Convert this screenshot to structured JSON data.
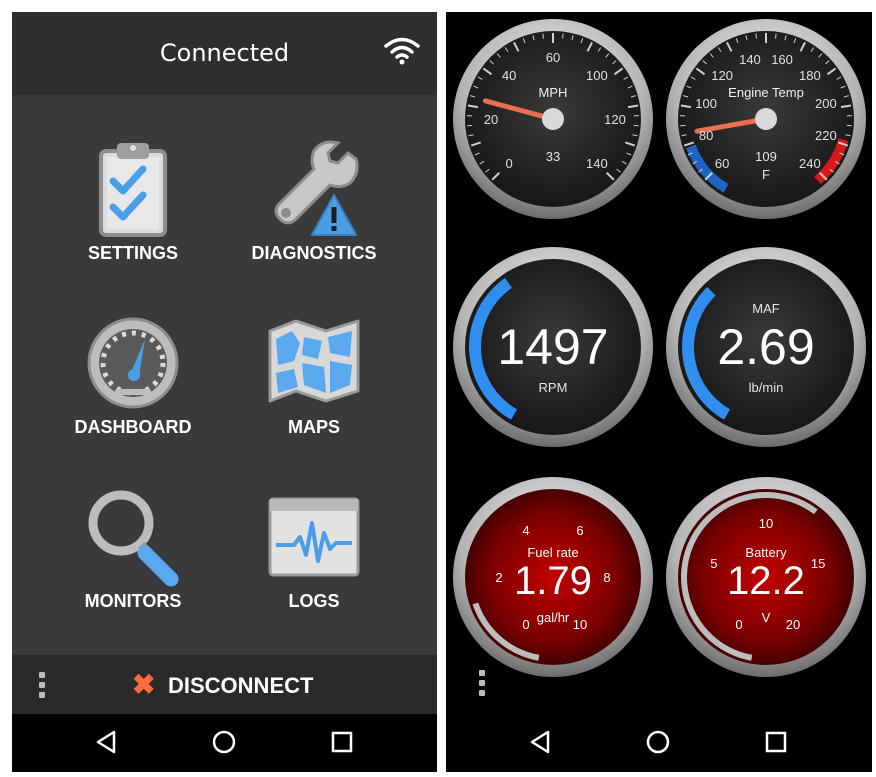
{
  "left_screen": {
    "status_title": "Connected",
    "wifi_icon": "wifi-icon",
    "menu": [
      {
        "label": "SETTINGS",
        "icon": "clipboard-checklist-icon"
      },
      {
        "label": "DIAGNOSTICS",
        "icon": "wrench-warning-icon"
      },
      {
        "label": "DASHBOARD",
        "icon": "gauge-icon"
      },
      {
        "label": "MAPS",
        "icon": "map-icon"
      },
      {
        "label": "MONITORS",
        "icon": "magnifier-icon"
      },
      {
        "label": "LOGS",
        "icon": "waveform-icon"
      }
    ],
    "disconnect_label": "DISCONNECT",
    "disconnect_icon": "close-x-icon",
    "accent_color": "#5aa9f0",
    "disconnect_color": "#ff6b3d"
  },
  "right_screen": {
    "gauges": [
      {
        "type": "analog",
        "title": "MPH",
        "value": "33",
        "ticks": [
          "0",
          "20",
          "40",
          "60",
          "100",
          "120",
          "140"
        ]
      },
      {
        "type": "analog",
        "title": "Engine Temp",
        "value": "109",
        "unit": "F",
        "ticks": [
          "60",
          "80",
          "100",
          "120",
          "140",
          "160",
          "180",
          "200",
          "220",
          "240"
        ]
      },
      {
        "type": "digital",
        "value": "1497",
        "unit": "RPM",
        "fill_fraction": 0.24
      },
      {
        "type": "digital",
        "title": "MAF",
        "value": "2.69",
        "unit": "lb/min",
        "fill_fraction": 0.22
      },
      {
        "type": "red",
        "title": "Fuel rate",
        "value": "1.79",
        "unit": "gal/hr",
        "ticks": [
          "0",
          "2",
          "4",
          "6",
          "8",
          "10"
        ],
        "fill_fraction": 0.18
      },
      {
        "type": "red",
        "title": "Battery",
        "value": "12.2",
        "unit": "V",
        "ticks": [
          "0",
          "5",
          "10",
          "15",
          "20"
        ],
        "fill_fraction": 0.61
      }
    ],
    "accent_color": "#2f8ef0"
  },
  "nav": {
    "back_icon": "back-triangle-icon",
    "home_icon": "home-circle-icon",
    "recents_icon": "recents-square-icon"
  }
}
